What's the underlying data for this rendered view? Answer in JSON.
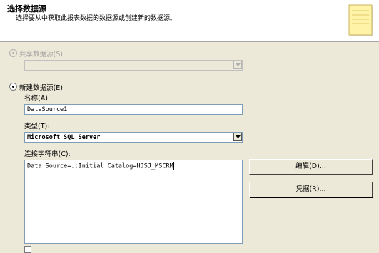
{
  "header": {
    "title": "选择数据源",
    "subtitle": "选择要从中获取此报表数据的数据源或创建新的数据源。"
  },
  "shared_source": {
    "label": "共享数据源(S)",
    "selected": false,
    "enabled": false,
    "value": ""
  },
  "new_source": {
    "label": "新建数据源(E)",
    "selected": true
  },
  "name": {
    "label": "名称(A):",
    "value": "DataSource1"
  },
  "type": {
    "label": "类型(T):",
    "value": "Microsoft SQL Server"
  },
  "connection": {
    "label": "连接字符串(C):",
    "value": "Data Source=.;Initial Catalog=HJSJ_MSCRM"
  },
  "buttons": {
    "edit": "编辑(D)...",
    "credentials": "凭据(R)..."
  },
  "colors": {
    "window_bg": "#ece9d8",
    "header_bg": "#ffffff",
    "field_border": "#7f9db9"
  },
  "icons": {
    "header": "note-icon",
    "dropdown": "chevron-down-icon"
  }
}
